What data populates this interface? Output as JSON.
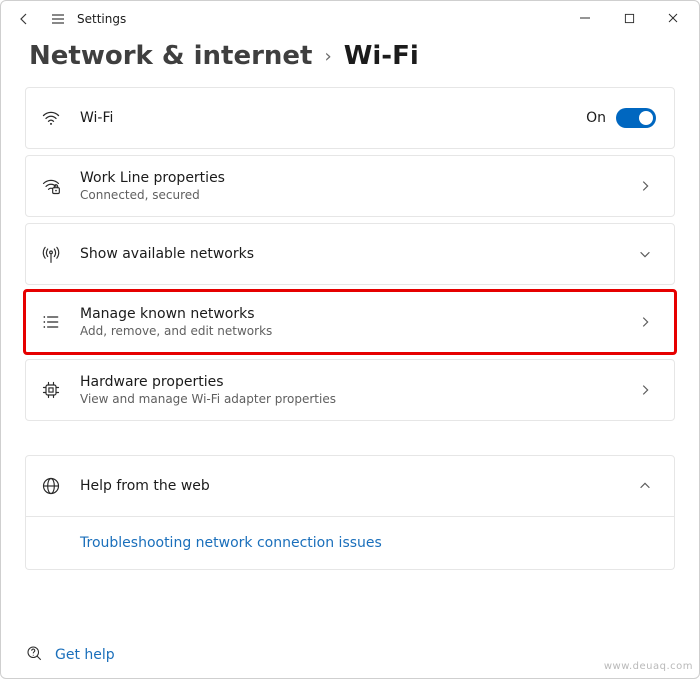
{
  "window": {
    "title": "Settings",
    "controls": {
      "minimize": "—",
      "maximize": "□",
      "close": "✕"
    }
  },
  "breadcrumb": {
    "parent": "Network & internet",
    "separator": "›",
    "current": "Wi-Fi"
  },
  "wifi_toggle": {
    "title": "Wi-Fi",
    "state_label": "On",
    "on": true
  },
  "items": [
    {
      "icon": "wifi-secure-icon",
      "title": "Work Line properties",
      "subtitle": "Connected, secured",
      "chevron": "right"
    },
    {
      "icon": "antenna-icon",
      "title": "Show available networks",
      "subtitle": "",
      "chevron": "down"
    },
    {
      "icon": "list-icon",
      "title": "Manage known networks",
      "subtitle": "Add, remove, and edit networks",
      "chevron": "right",
      "highlight": true
    },
    {
      "icon": "chip-icon",
      "title": "Hardware properties",
      "subtitle": "View and manage Wi-Fi adapter properties",
      "chevron": "right"
    }
  ],
  "help": {
    "header": "Help from the web",
    "link": "Troubleshooting network connection issues"
  },
  "footer": {
    "get_help": "Get help"
  },
  "watermark": "www.deuaq.com"
}
